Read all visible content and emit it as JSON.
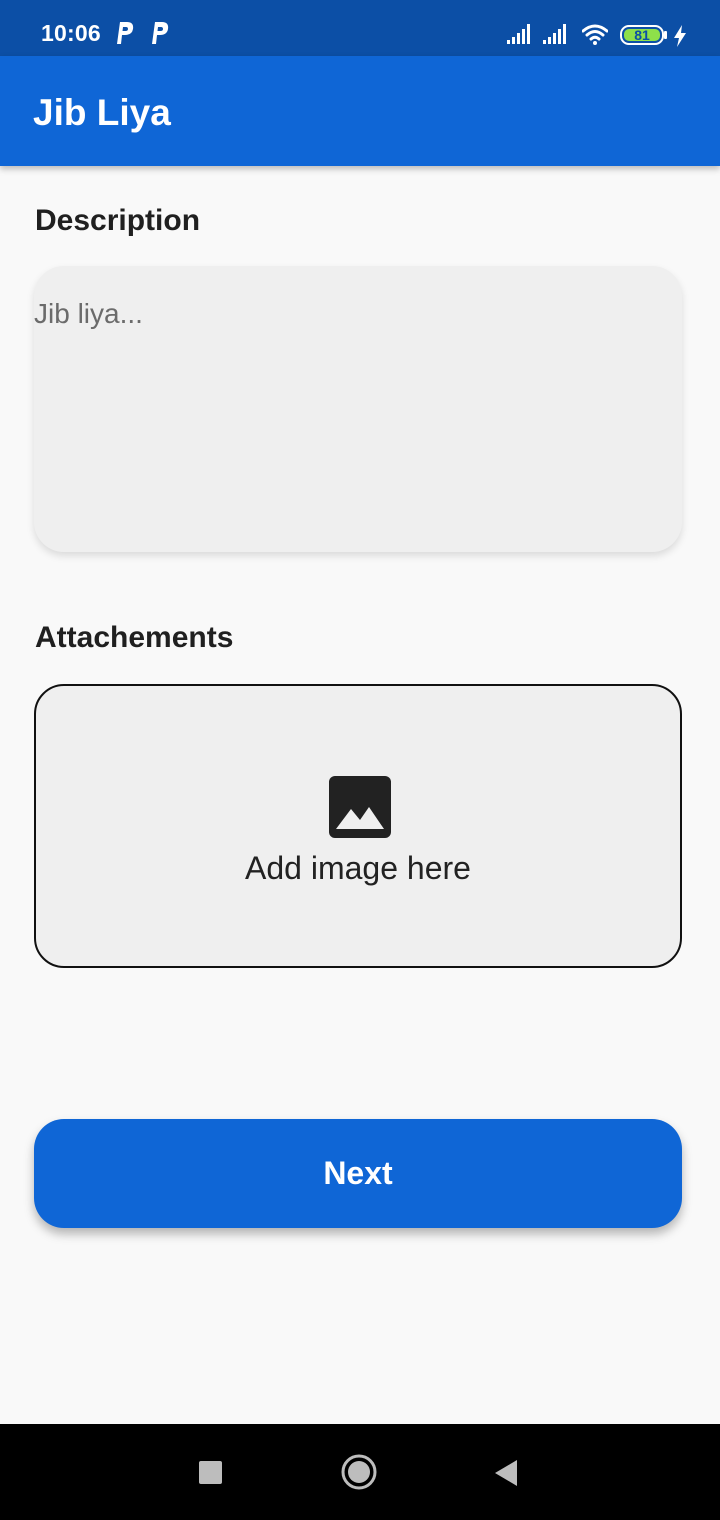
{
  "status_bar": {
    "time": "10:06",
    "battery_level": "81",
    "icons": [
      "parking-icon",
      "parking-icon",
      "signal-icon",
      "signal-icon",
      "wifi-icon",
      "battery-icon",
      "charging-bolt-icon"
    ]
  },
  "app_bar": {
    "title": "Jib Liya"
  },
  "description": {
    "label": "Description",
    "placeholder": "Jib liya...",
    "value": ""
  },
  "attachments": {
    "label": "Attachements",
    "prompt": "Add image here",
    "icon": "image-icon"
  },
  "actions": {
    "next_label": "Next"
  },
  "nav_bar": {
    "icons": [
      "recents-square-icon",
      "home-circle-icon",
      "back-triangle-icon"
    ]
  },
  "colors": {
    "status_bar": "#0c4fa6",
    "primary": "#0f66d6",
    "background": "#f9f9f9",
    "field_fill": "#efefef",
    "battery_fill": "#8ee04a"
  }
}
